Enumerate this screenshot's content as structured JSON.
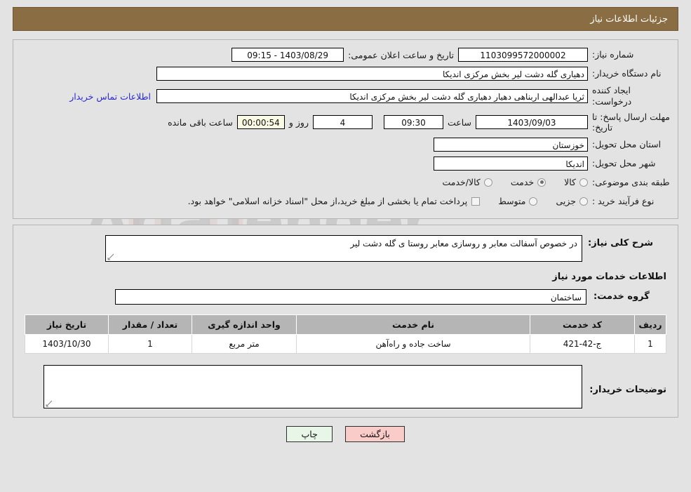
{
  "header": {
    "title": "جزئیات اطلاعات نیاز",
    "bar_color": "#8a6d43",
    "text_color": "#ffffff"
  },
  "top_form": {
    "need_number_label": "شماره نیاز:",
    "need_number_value": "1103099572000002",
    "announce_datetime_label": "تاریخ و ساعت اعلان عمومی:",
    "announce_datetime_value": "1403/08/29 - 09:15",
    "buyer_org_label": "نام دستگاه خریدار:",
    "buyer_org_value": "دهیاری گله دشت لیر بخش مرکزی اندیکا",
    "requester_label": "ایجاد کننده درخواست:",
    "requester_value": "ثریا عبدالهی اربناهی دهیار دهیاری گله دشت لیر بخش مرکزی اندیکا",
    "contact_link": "اطلاعات تماس خریدار",
    "deadline_label": "مهلت ارسال پاسخ: تا تاریخ:",
    "deadline_date_value": "1403/09/03",
    "deadline_hour_label": "ساعت",
    "deadline_hour_value": "09:30",
    "remaining_days_value": "4",
    "remaining_days_sep": "روز و",
    "remaining_clock_value": "00:00:54",
    "remaining_suffix": "ساعت باقی مانده",
    "province_label": "استان محل تحویل:",
    "province_value": "خوزستان",
    "city_label": "شهر محل تحویل:",
    "city_value": "اندیکا",
    "category_label": "طبقه بندی موضوعی:",
    "category_options": [
      {
        "label": "کالا",
        "checked": false
      },
      {
        "label": "خدمت",
        "checked": true
      },
      {
        "label": "کالا/خدمت",
        "checked": false
      }
    ],
    "process_label": "نوع فرآیند خرید :",
    "process_options": [
      {
        "label": "جزیی",
        "checked": false
      },
      {
        "label": "متوسط",
        "checked": false
      }
    ],
    "treasury_checkbox_checked": false,
    "treasury_note": "پرداخت تمام یا بخشی از مبلغ خرید،از محل \"اسناد خزانه اسلامی\" خواهد بود."
  },
  "mid_form": {
    "general_desc_label": "شرح کلی نیاز:",
    "general_desc_value": "در خصوص  آسفالت  معابر و روسازی معابر  روستا ی گله دشت لیر",
    "services_section_title": "اطلاعات خدمات مورد نیاز",
    "service_group_label": "گروه خدمت:",
    "service_group_value": "ساختمان",
    "table": {
      "columns": [
        "ردیف",
        "کد خدمت",
        "نام خدمت",
        "واحد اندازه گیری",
        "تعداد / مقدار",
        "تاریخ نیاز"
      ],
      "rows": [
        {
          "radif": "1",
          "code": "ج-42-421",
          "name": "ساخت جاده و راه‌آهن",
          "unit": "متر مربع",
          "qty": "1",
          "date": "1403/10/30"
        }
      ]
    },
    "buyer_comments_label": "توضیحات خریدار:",
    "buyer_comments_value": ""
  },
  "buttons": {
    "print_label": "چاپ",
    "print_color": "#e8f6e8",
    "back_label": "بازگشت",
    "back_color": "#f9ccc9"
  },
  "watermark": {
    "text": "AriaTender",
    "suffix": ".net"
  }
}
